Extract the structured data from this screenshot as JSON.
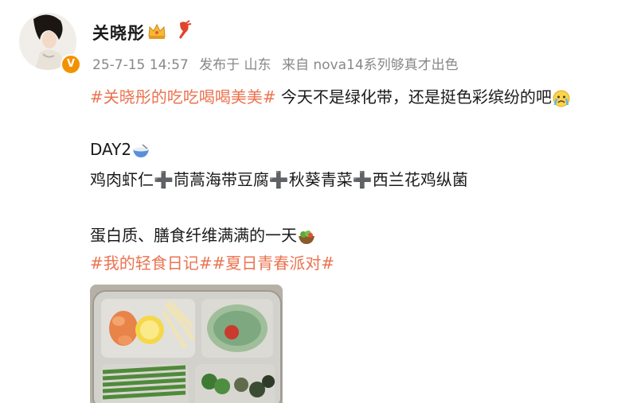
{
  "user": {
    "name": "关晓彤",
    "verified_mark": "V",
    "icons": [
      "crown-icon",
      "lobster-icon"
    ]
  },
  "meta": {
    "time": "25-7-15 14:57",
    "location": "发布于 山东",
    "device": "来自 nova14系列够真才出色"
  },
  "post": {
    "line1_tag": "#关晓彤的吃吃喝喝美美#",
    "line1_text": " 今天不是绿化带，还是挺色彩缤纷的吧",
    "line2": "DAY2",
    "line3": "鸡肉虾仁➕茼蒿海带豆腐➕秋葵青菜➕西兰花鸡纵菌",
    "line4": "蛋白质、膳食纤维满满的一天",
    "line5_tags": "#我的轻食日记##夏日青春派对#"
  },
  "colors": {
    "accent_tag": "#eb7350",
    "meta_gray": "#888888",
    "verified": "#f39200"
  }
}
